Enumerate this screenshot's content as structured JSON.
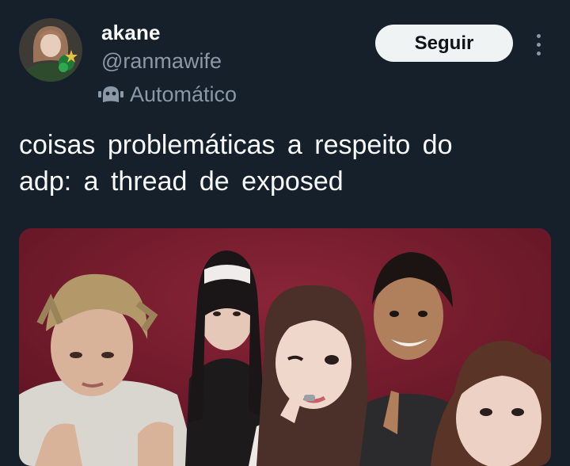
{
  "user": {
    "display_name": "akane",
    "handle": "@ranmawife",
    "automated_label": "Automático",
    "avatar_icon": "profile-photo"
  },
  "actions": {
    "follow_label": "Seguir",
    "more_icon": "more-vertical-icon"
  },
  "tweet": {
    "text_line1": "coisas problemáticas a respeito do",
    "text_line2": "adp: a thread de exposed",
    "media_alt": "group photo of five people against a dark red background"
  },
  "colors": {
    "background": "#15202b",
    "primary_text": "#f7f9f9",
    "secondary_text": "#8b98a5",
    "follow_button_bg": "#eff3f4",
    "follow_button_text": "#0f1419",
    "media_backdrop": "#7a1d30"
  }
}
